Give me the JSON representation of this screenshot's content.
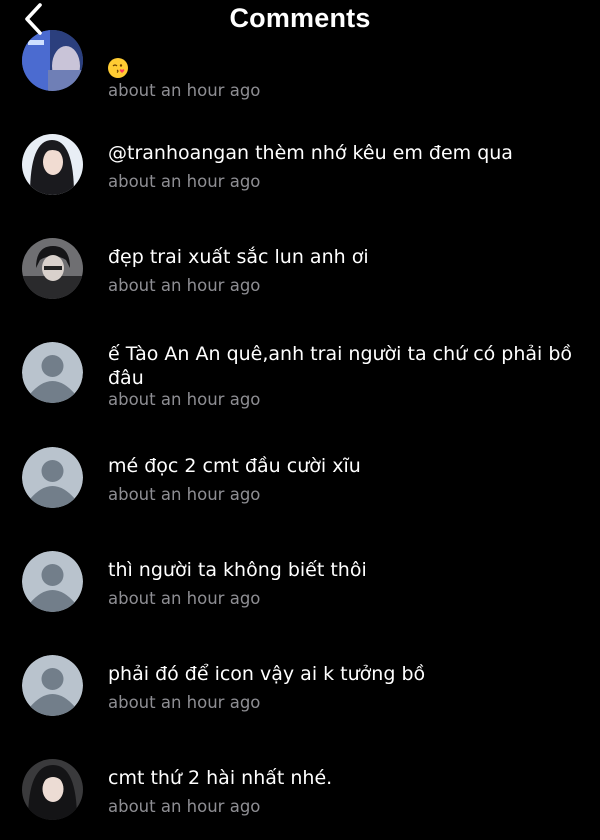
{
  "header": {
    "title": "Comments"
  },
  "colors": {
    "background": "#000000",
    "text": "#ffffff",
    "secondary": "#8e8e93",
    "placeholder_avatar": "#b9c3cd",
    "placeholder_figure": "#727e8a"
  },
  "comments": [
    {
      "text": "",
      "emoji": "face-blowing-kiss",
      "time": "about an hour ago",
      "avatar": "photo"
    },
    {
      "text": "@tranhoangan thèm nhớ kêu em đem qua",
      "time": "about an hour ago",
      "avatar": "photo"
    },
    {
      "text": "đẹp trai xuất sắc lun anh ơi",
      "time": "about an hour ago",
      "avatar": "photo"
    },
    {
      "text": "ế Tào An An quê,anh trai người ta chứ có phải bồ đâu",
      "time": "about an hour ago",
      "avatar": "default-user"
    },
    {
      "text": "mé đọc 2 cmt đầu cười xĩu",
      "time": "about an hour ago",
      "avatar": "default-user"
    },
    {
      "text": "thì người ta không biết thôi",
      "time": "about an hour ago",
      "avatar": "default-user"
    },
    {
      "text": "phải đó để icon vậy ai k tưởng bồ",
      "time": "about an hour ago",
      "avatar": "default-user"
    },
    {
      "text": "cmt thứ 2 hài nhất nhé.",
      "time": "about an hour ago",
      "avatar": "photo"
    }
  ]
}
